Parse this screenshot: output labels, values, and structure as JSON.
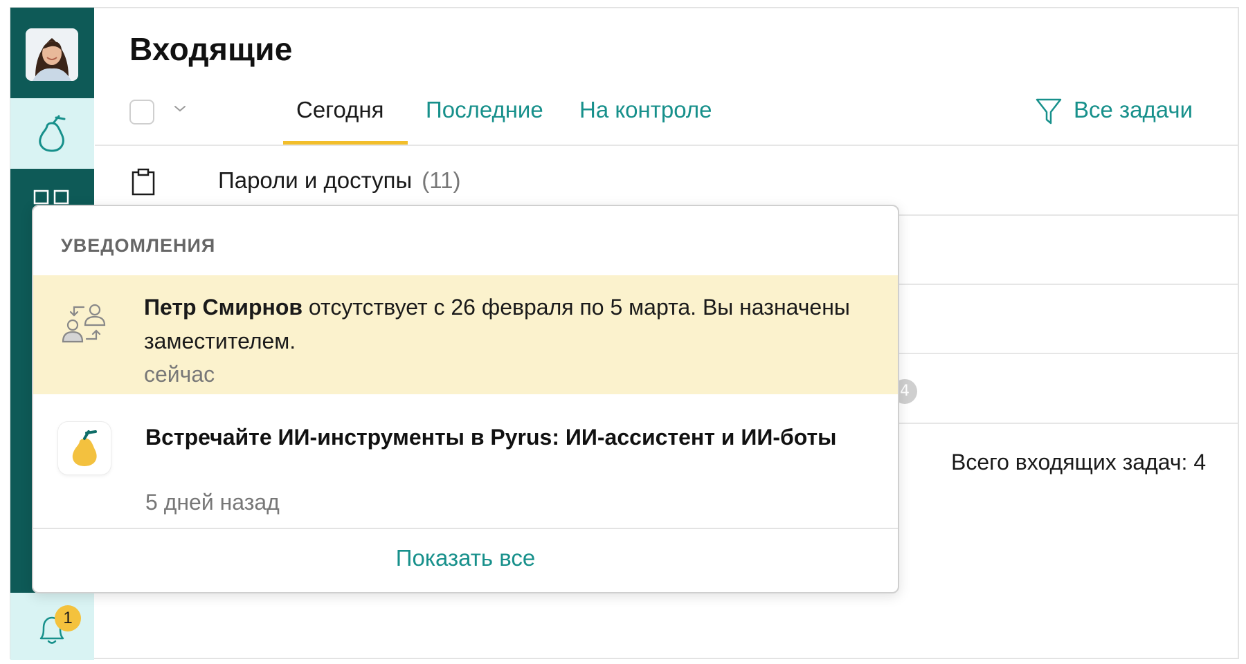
{
  "header": {
    "title": "Входящие"
  },
  "tabs": [
    {
      "label": "Сегодня",
      "active": true
    },
    {
      "label": "Последние",
      "active": false
    },
    {
      "label": "На контроле",
      "active": false
    }
  ],
  "filter": {
    "label": "Все задачи",
    "icon": "filter-icon"
  },
  "list": {
    "rows": [
      {
        "title": "Пароли и доступы",
        "count": "(11)",
        "icon": "clipboard-icon"
      }
    ],
    "hidden_badge": "4",
    "total_text": "Всего входящих задач: 4"
  },
  "sidebar": {
    "bell_badge": "1",
    "icons": [
      "avatar",
      "pear-logo-icon",
      "grid-icon",
      "bell-icon"
    ]
  },
  "notifications": {
    "header": "УВЕДОМЛЕНИЯ",
    "items": [
      {
        "author": "Петр Смирнов",
        "text": " отсутствует с 26 февраля по 5 марта. Вы назначены заместителем.",
        "time": "сейчас",
        "icon": "substitute-users-icon"
      },
      {
        "title": "Встречайте ИИ-инструменты в Pyrus: ИИ-ассистент и ИИ-боты",
        "time": "5 дней назад",
        "icon": "pyrus-pear-icon"
      }
    ],
    "show_all": "Показать все"
  },
  "colors": {
    "sidebar": "#0e5a57",
    "sidebar_active": "#d9f3f3",
    "accent": "#17908b",
    "tab_underline": "#f2be2b",
    "highlight": "#fbf2cd",
    "badge": "#f4c23d"
  }
}
